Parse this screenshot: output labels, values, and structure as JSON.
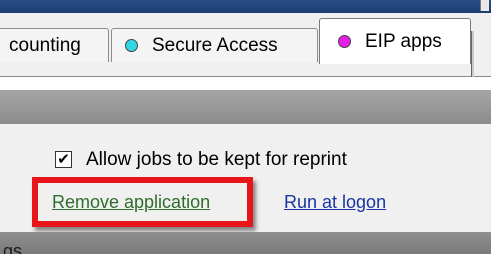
{
  "window": {
    "title_bar_color": "#1d3d70"
  },
  "tabs": [
    {
      "label": "counting",
      "active": false,
      "dot_color": null
    },
    {
      "label": "Secure Access",
      "active": false,
      "dot_color": "#33d6e6"
    },
    {
      "label": "EIP apps",
      "active": true,
      "dot_color": "#e61ee6"
    }
  ],
  "panel": {
    "checkbox_label": "Allow jobs to be kept for reprint",
    "checkbox_checked": true,
    "checkbox_mark": "✔",
    "remove_link": "Remove application",
    "run_link": "Run at logon",
    "section_label": "gs"
  },
  "highlight": {
    "color": "#e8161b",
    "target": "Remove application"
  }
}
